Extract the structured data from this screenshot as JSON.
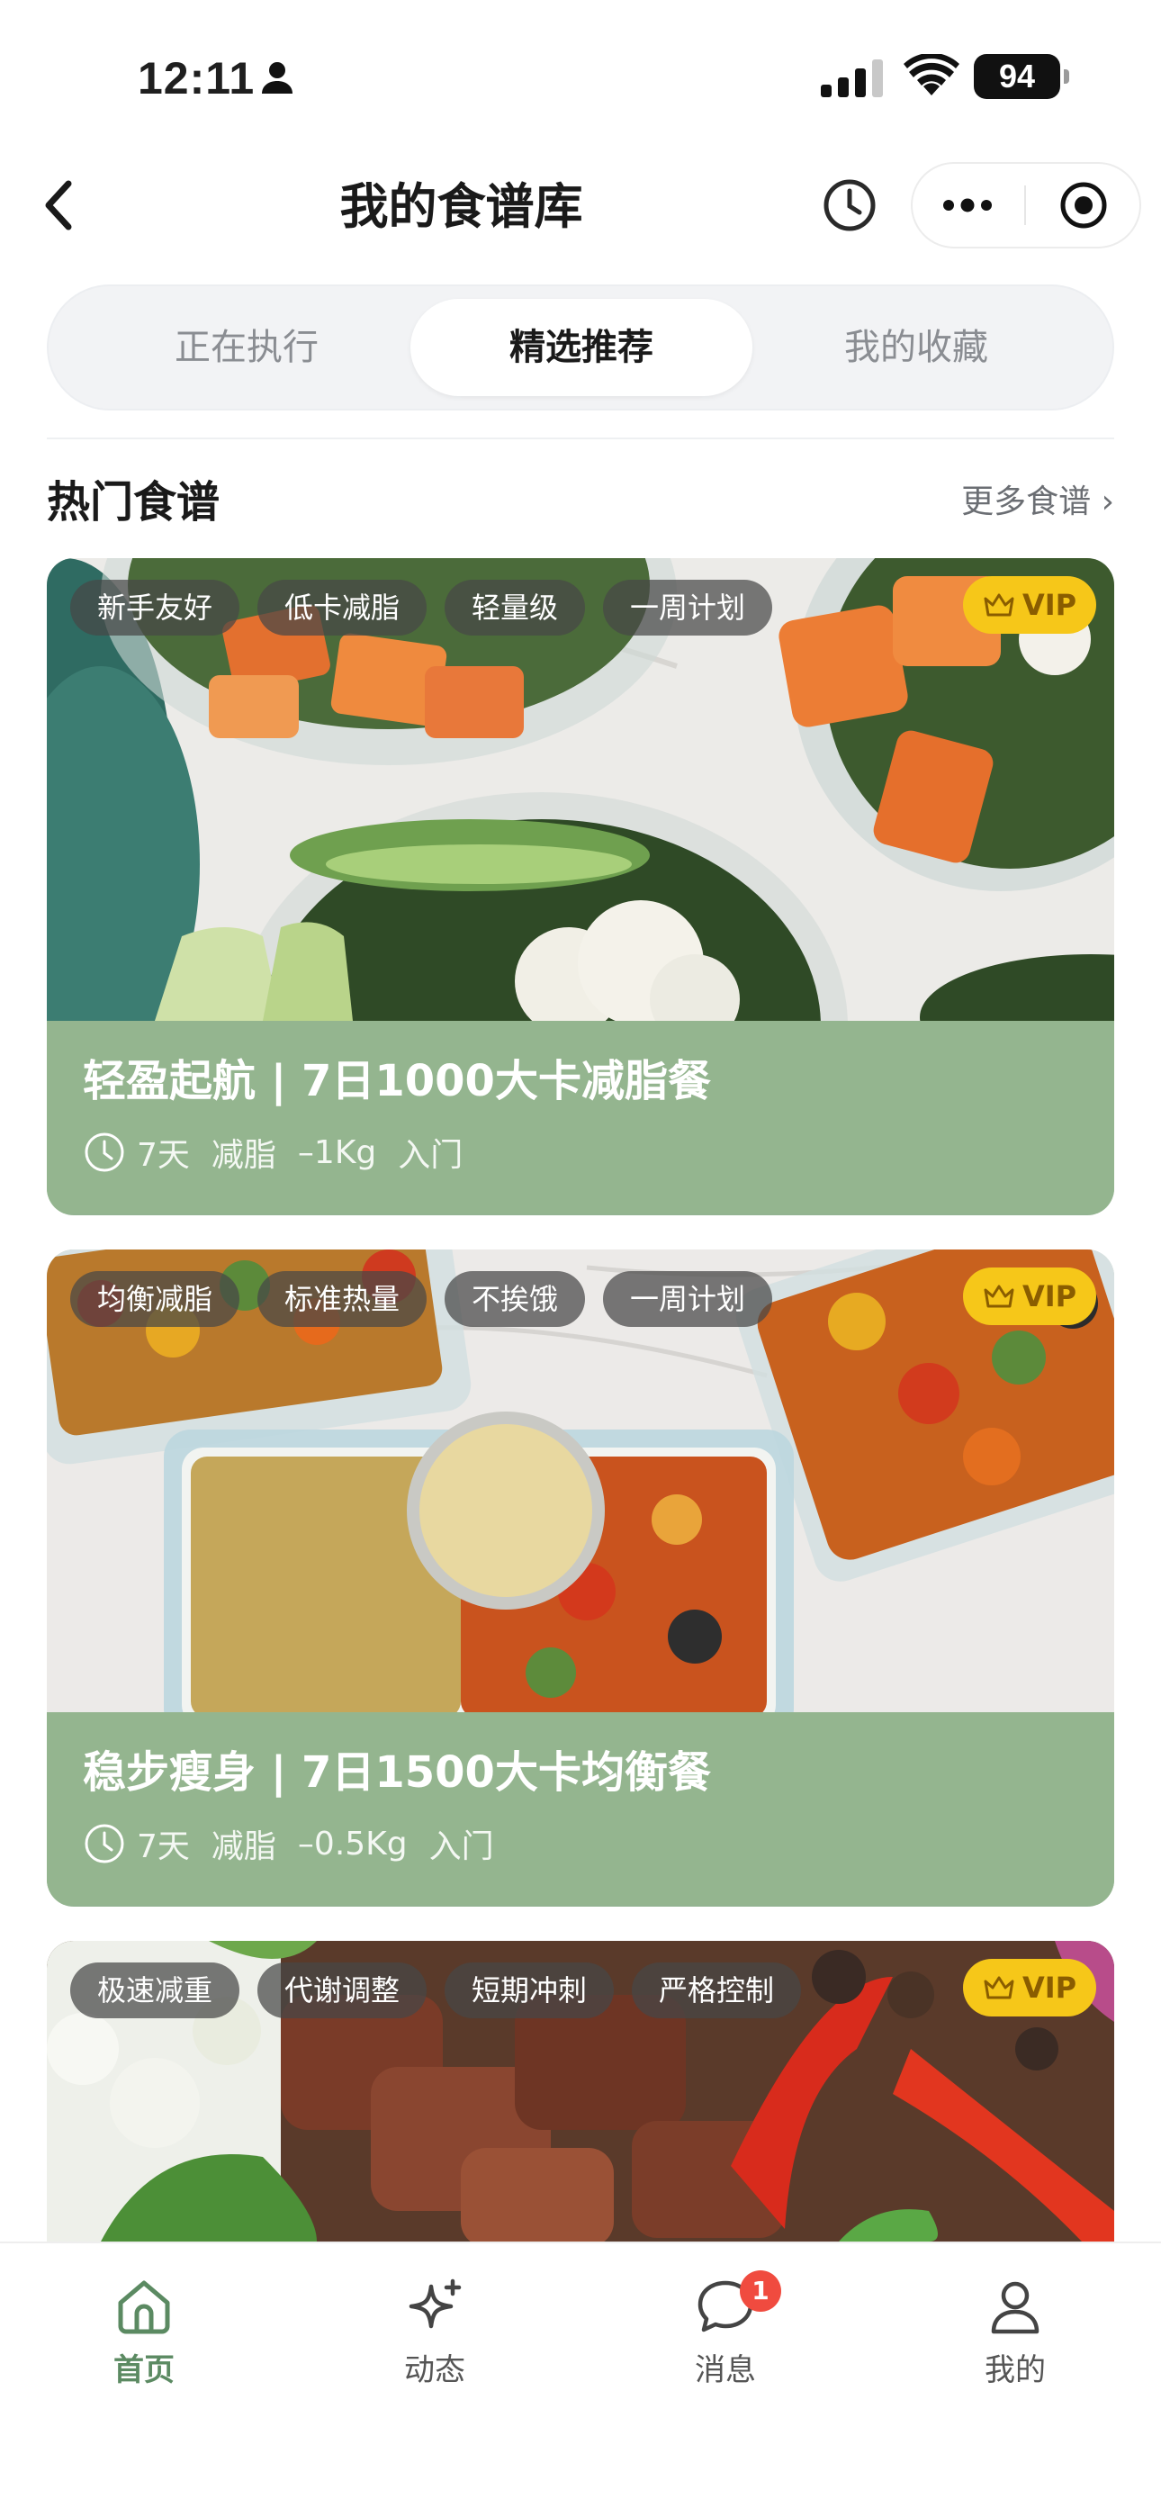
{
  "status_bar": {
    "time": "12:11",
    "battery": "94"
  },
  "nav": {
    "title": "我的食谱库"
  },
  "segments": [
    {
      "label": "正在执行",
      "active": false
    },
    {
      "label": "精选推荐",
      "active": true
    },
    {
      "label": "我的收藏",
      "active": false
    }
  ],
  "section": {
    "title": "热门食谱",
    "more": "更多食谱 ›"
  },
  "cards": [
    {
      "tags": [
        "新手友好",
        "低卡减脂",
        "轻量级",
        "一周计划"
      ],
      "vip": "VIP",
      "title": "轻盈起航 | 7日1000大卡减脂餐",
      "meta": [
        "7天",
        "减脂",
        "–1Kg",
        "入门"
      ]
    },
    {
      "tags": [
        "均衡减脂",
        "标准热量",
        "不挨饿",
        "一周计划"
      ],
      "vip": "VIP",
      "title": "稳步瘦身 | 7日1500大卡均衡餐",
      "meta": [
        "7天",
        "减脂",
        "–0.5Kg",
        "入门"
      ]
    },
    {
      "tags": [
        "极速减重",
        "代谢调整",
        "短期冲刺",
        "严格控制"
      ],
      "vip": "VIP"
    }
  ],
  "tabbar": [
    {
      "label": "首页",
      "icon": "home-icon",
      "active": true
    },
    {
      "label": "动态",
      "icon": "sparkle-icon",
      "active": false
    },
    {
      "label": "消息",
      "icon": "chat-icon",
      "badge": "1",
      "active": false
    },
    {
      "label": "我的",
      "icon": "person-icon",
      "active": false
    }
  ],
  "colors": {
    "accent": "#5b8a62",
    "card_green": "#94b58f",
    "vip": "#f6c719",
    "badge": "#f04b3f"
  }
}
